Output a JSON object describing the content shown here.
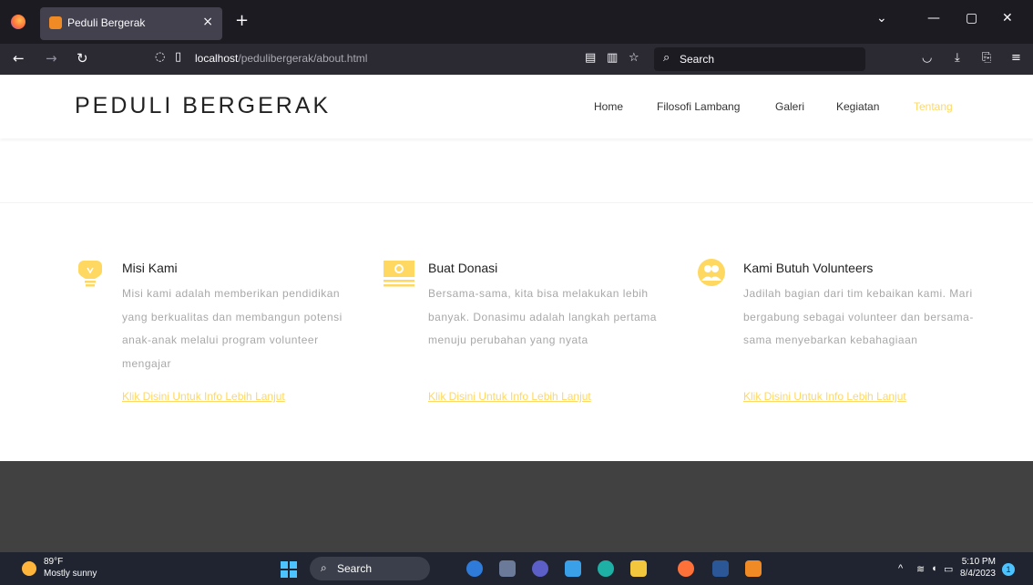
{
  "browser": {
    "tab_title": "Peduli Bergerak",
    "tab_close": "×",
    "new_tab": "+",
    "url_host": "localhost",
    "url_path": "/pedulibergerak/about.html",
    "search_placeholder": "Search",
    "window_controls": [
      "⌄",
      "—",
      "▢",
      "✕"
    ]
  },
  "site": {
    "brand": "PEDULI BERGERAK",
    "nav": [
      {
        "label": "Home"
      },
      {
        "label": "Filosofi Lambang"
      },
      {
        "label": "Galeri"
      },
      {
        "label": "Kegiatan"
      },
      {
        "label": "Tentang",
        "active": true
      }
    ],
    "accent_color": "#ffd862"
  },
  "features": [
    {
      "icon": "lightbulb-icon",
      "title": "Misi Kami",
      "text": "Misi kami adalah memberikan pendidikan yang berkualitas dan membangun potensi anak-anak melalui program volunteer mengajar",
      "link": "Klik Disini Untuk Info Lebih Lanjut"
    },
    {
      "icon": "money-icon",
      "title": "Buat Donasi",
      "text": "Bersama-sama, kita bisa melakukan lebih banyak. Donasimu adalah langkah pertama menuju perubahan yang nyata",
      "link": "Klik Disini Untuk Info Lebih Lanjut"
    },
    {
      "icon": "people-icon",
      "title": "Kami Butuh Volunteers",
      "text": "Jadilah bagian dari tim kebaikan kami. Mari bergabung sebagai volunteer dan bersama-sama menyebarkan kebahagiaan",
      "link": "Klik Disini Untuk Info Lebih Lanjut"
    }
  ],
  "taskbar": {
    "temperature": "89°F",
    "weather": "Mostly sunny",
    "search": "Search",
    "time": "5:10 PM",
    "date": "8/4/2023",
    "notifications": "1"
  }
}
